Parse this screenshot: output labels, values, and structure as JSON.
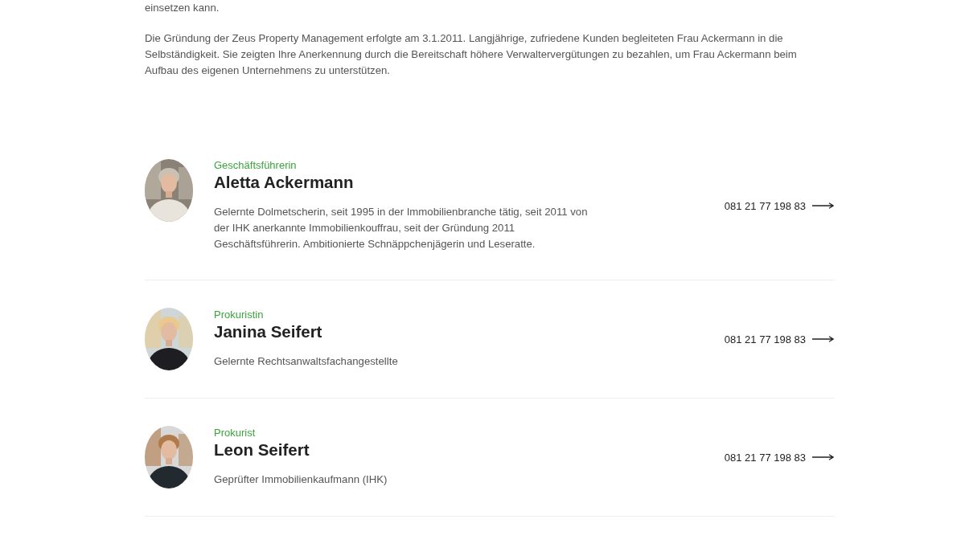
{
  "intro": [
    "einsetzen kann.",
    "Die Gründung der Zeus Property Management erfolgte am 3.1.2011. Langjährige, zufriedene Kunden begleiteten Frau Ackermann in die Selbständigkeit. Sie zeigten Ihre Anerkennung durch die Bereitschaft höhere Verwaltervergütungen zu bezahlen, um Frau Ackermann beim Aufbau des eigenen Unternehmens zu unterstützen."
  ],
  "team": [
    {
      "role": "Geschäftsführerin",
      "name": "Aletta Ackermann",
      "description": "Gelernte Dolmetscherin, seit 1995 in der Immobilienbranche tätig, seit 2011 von der IHK anerkannte Immobilienkouffrau, seit der Gründung 2011 Geschäftsführerin. Ambitionierte Schnäppchenjägerin und Leseratte.",
      "phone": "081 21 77 198 83"
    },
    {
      "role": "Prokuristin",
      "name": "Janina Seifert",
      "description": "Gelernte Rechtsanwaltsfachangestellte",
      "phone": "081 21 77 198 83"
    },
    {
      "role": "Prokurist",
      "name": "Leon Seifert",
      "description": "Geprüfter Immobilienkaufmann (IHK)",
      "phone": "081 21 77 198 83"
    }
  ]
}
